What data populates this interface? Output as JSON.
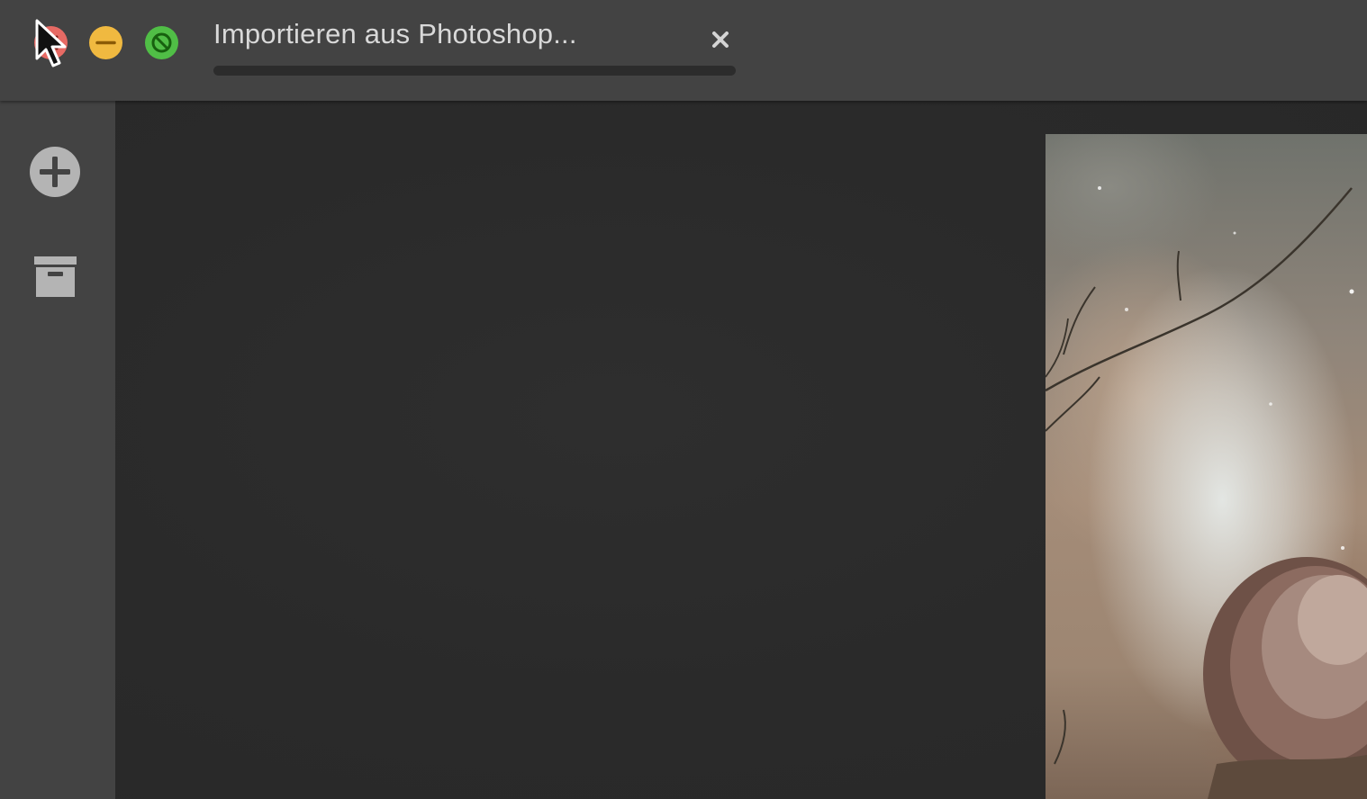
{
  "window": {
    "controls": [
      {
        "name": "close",
        "color": "#e76a64"
      },
      {
        "name": "minimize",
        "color": "#f0b940"
      },
      {
        "name": "zoom",
        "color": "#50be46"
      }
    ]
  },
  "tab": {
    "title": "Importieren aus Photoshop...",
    "close_icon": "close-icon"
  },
  "sidebar": {
    "items": [
      {
        "icon": "plus-circle-icon"
      },
      {
        "icon": "archive-box-icon"
      }
    ]
  },
  "colors": {
    "titlebar": "#434343",
    "sidebar": "#434343",
    "content": "#2a2a2a",
    "text": "#d9d9d9"
  }
}
